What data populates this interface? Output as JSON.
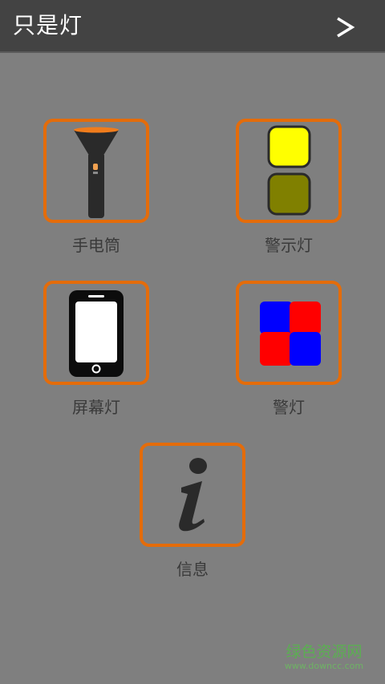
{
  "app_bar": {
    "title": "只是灯",
    "next_label": ">"
  },
  "tiles": [
    {
      "label": "手电筒",
      "icon": "flashlight-icon"
    },
    {
      "label": "警示灯",
      "icon": "warning-light-icon"
    },
    {
      "label": "屏幕灯",
      "icon": "phone-screen-icon"
    },
    {
      "label": "警灯",
      "icon": "police-light-icon"
    },
    {
      "label": "信息",
      "icon": "info-icon"
    }
  ],
  "watermark": {
    "main": "绿色资源网",
    "sub": "www.downcc.com"
  },
  "colors": {
    "background": "#7f7f7f",
    "app_bar": "#434343",
    "tile_border": "#e46c0a",
    "flashlight_glow": "#f07c1c",
    "warning_bright": "#ffff00",
    "warning_dim": "#808000",
    "police_blue": "#0000ff",
    "police_red": "#ff0000",
    "watermark": "#55b84a"
  }
}
